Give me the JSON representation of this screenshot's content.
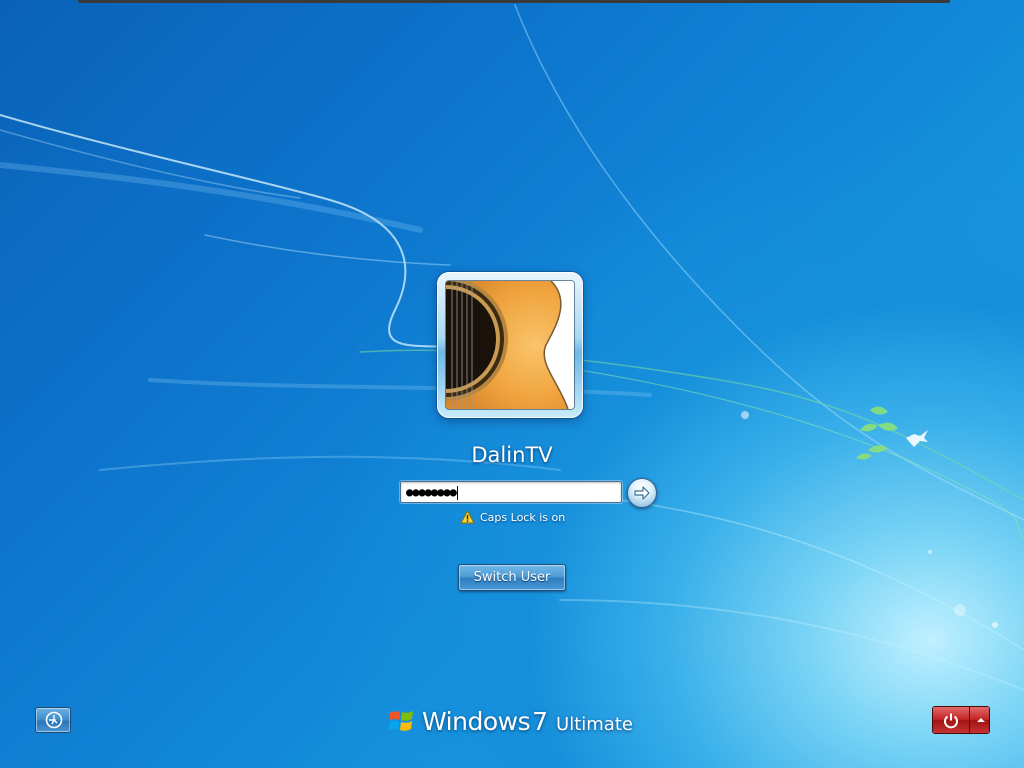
{
  "user": {
    "name": "DalinTV",
    "avatar_icon": "guitar-avatar"
  },
  "password": {
    "masked_value": "●●●●●●●●"
  },
  "warnings": {
    "caps_lock": "Caps Lock is on"
  },
  "buttons": {
    "switch_user": "Switch User",
    "submit_icon": "arrow-right-icon",
    "ease_of_access_icon": "ease-of-access-icon",
    "power_icon": "power-icon",
    "power_options_icon": "chevron-up-icon"
  },
  "branding": {
    "windows": "Windows",
    "version": "7",
    "edition": "Ultimate"
  },
  "colors": {
    "background": "#1288d8",
    "power_button": "#c22424"
  }
}
